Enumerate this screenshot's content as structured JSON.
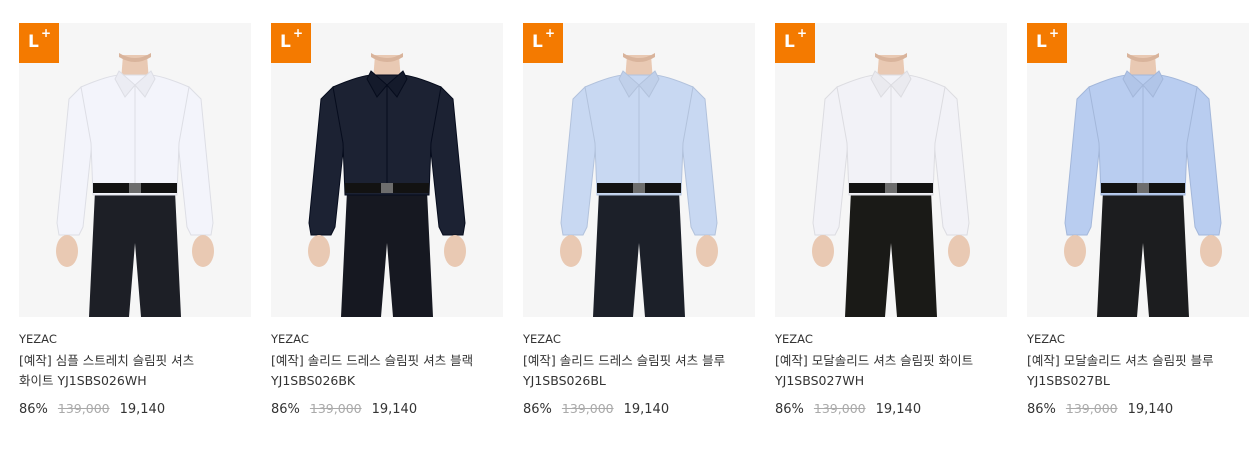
{
  "badge": {
    "letter": "L",
    "plus": "+",
    "color": "#f47a00"
  },
  "products": [
    {
      "brand": "YEZAC",
      "name": "[예작] 심플 스트레치 슬림핏 셔츠 화이트 YJ1SBS026WH",
      "discount_rate": "86%",
      "original_price": "139,000",
      "sale_price": "19,140",
      "shirt_color": "#f3f4fb",
      "pants_color": "#1d1f26"
    },
    {
      "brand": "YEZAC",
      "name": "[예작] 솔리드 드레스 슬림핏 셔츠 블랙 YJ1SBS026BK",
      "discount_rate": "86%",
      "original_price": "139,000",
      "sale_price": "19,140",
      "shirt_color": "#1c2233",
      "pants_color": "#161821"
    },
    {
      "brand": "YEZAC",
      "name": "[예작] 솔리드 드레스 슬림핏 셔츠 블루 YJ1SBS026BL",
      "discount_rate": "86%",
      "original_price": "139,000",
      "sale_price": "19,140",
      "shirt_color": "#c8d8f2",
      "pants_color": "#1c2029"
    },
    {
      "brand": "YEZAC",
      "name": "[예작] 모달솔리드 셔츠 슬림핏 화이트 YJ1SBS027WH",
      "discount_rate": "86%",
      "original_price": "139,000",
      "sale_price": "19,140",
      "shirt_color": "#f2f2f7",
      "pants_color": "#1a1a17"
    },
    {
      "brand": "YEZAC",
      "name": "[예작] 모달솔리드 셔츠 슬림핏 블루 YJ1SBS027BL",
      "discount_rate": "86%",
      "original_price": "139,000",
      "sale_price": "19,140",
      "shirt_color": "#b9cdf0",
      "pants_color": "#1c1d1f"
    }
  ]
}
